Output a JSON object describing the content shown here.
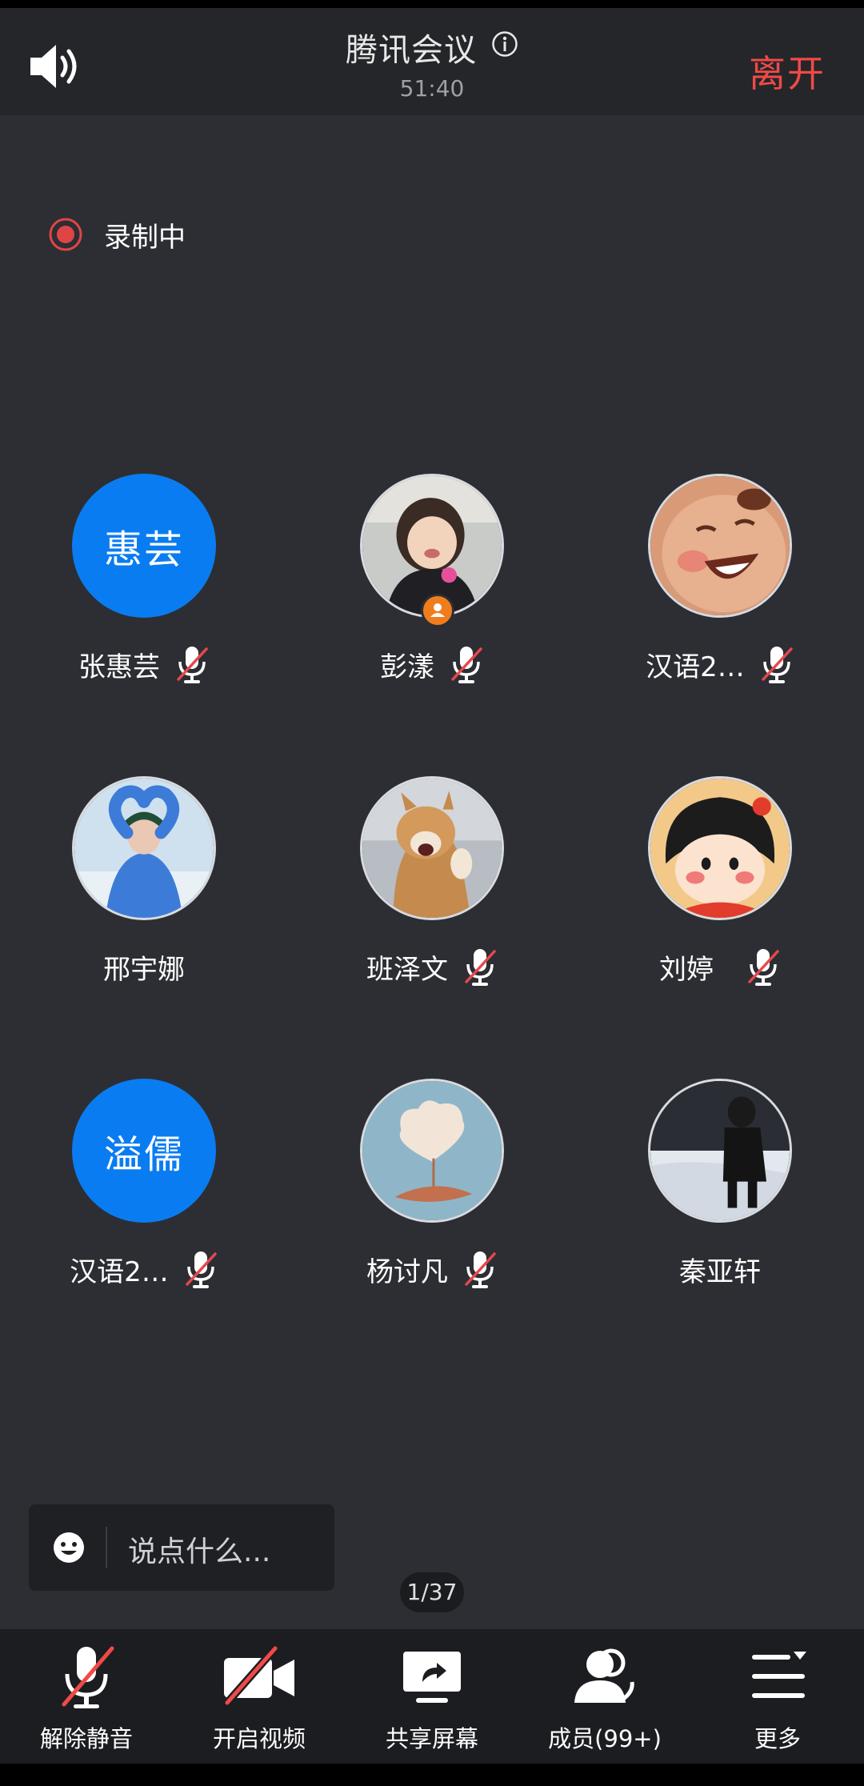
{
  "header": {
    "title": "腾讯会议",
    "timer": "51:40",
    "leave_label": "离开"
  },
  "recording": {
    "label": "录制中"
  },
  "participants": [
    {
      "name": "张惠芸",
      "initials": "惠芸",
      "avatar": "initials",
      "muted": true
    },
    {
      "name": "彭漾",
      "avatar": "photo-child",
      "muted": true,
      "host": true
    },
    {
      "name": "汉语2…",
      "avatar": "cartoon-baby",
      "muted": true
    },
    {
      "name": "邢宇娜",
      "avatar": "photo-heart-hands",
      "muted": false
    },
    {
      "name": "班泽文",
      "avatar": "photo-dog",
      "muted": true
    },
    {
      "name": "刘婷",
      "avatar": "cartoon-girl",
      "muted": true
    },
    {
      "name": "汉语2…",
      "initials": "溢儒",
      "avatar": "initials",
      "muted": true
    },
    {
      "name": "杨讨凡",
      "avatar": "photo-cloud-umbrella",
      "muted": true
    },
    {
      "name": "秦亚轩",
      "avatar": "photo-snow-person",
      "muted": false
    }
  ],
  "chat": {
    "placeholder": "说点什么..."
  },
  "pager": {
    "text": "1/37"
  },
  "toolbar": [
    {
      "label": "解除静音",
      "icon": "mic-off-icon"
    },
    {
      "label": "开启视频",
      "icon": "video-off-icon"
    },
    {
      "label": "共享屏幕",
      "icon": "share-screen-icon"
    },
    {
      "label": "成员(99+)",
      "icon": "members-icon"
    },
    {
      "label": "更多",
      "icon": "more-icon"
    }
  ],
  "colors": {
    "accent_red": "#f04a47",
    "avatar_blue": "#0a7cf2",
    "background": "#2c2e33"
  }
}
